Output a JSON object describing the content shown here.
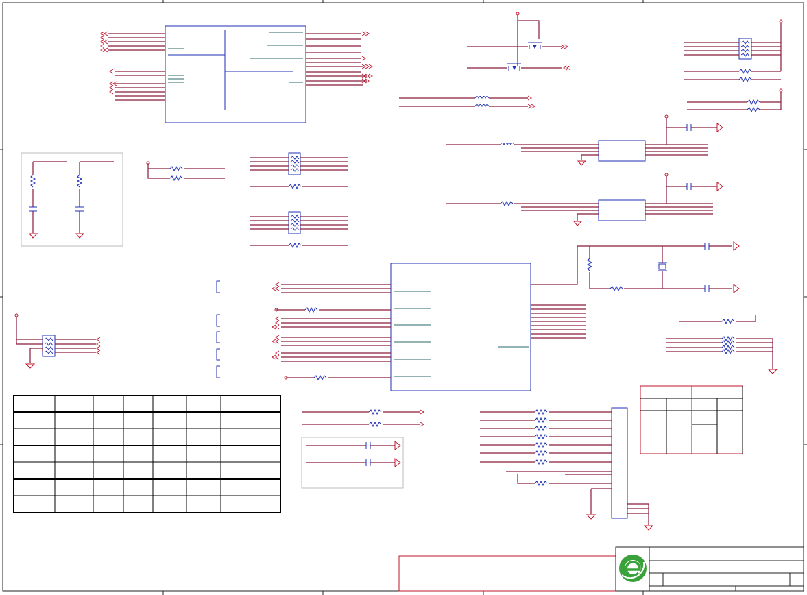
{
  "sheet": {
    "description_visible_text": [],
    "frame_color": "#222222",
    "wire_color": "#8a1a3a",
    "component_color": "#1f2fb5",
    "pin_color": "#c0162d",
    "table_color": "#000000",
    "rev_table_color": "#c0162d",
    "logo_color": "#3aa23a"
  },
  "logo": {
    "icon": "e-logo-icon"
  }
}
